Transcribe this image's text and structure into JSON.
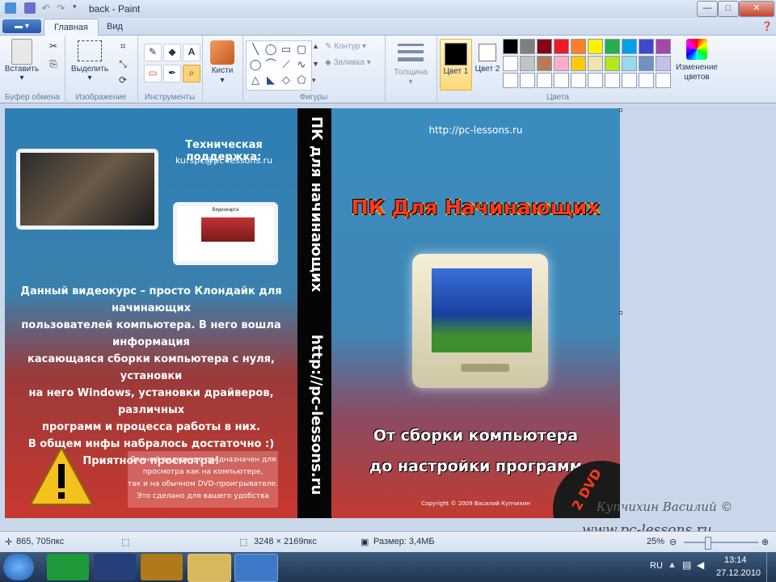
{
  "window": {
    "title": "back - Paint",
    "minimize_glyph": "—",
    "maximize_glyph": "□",
    "close_glyph": "✕"
  },
  "tabs": {
    "menu_glyph": "▬ ▾",
    "home": "Главная",
    "view": "Вид"
  },
  "ribbon": {
    "clipboard": {
      "paste": "Вставить",
      "label": "Буфер обмена"
    },
    "image": {
      "select": "Выделить",
      "label": "Изображение"
    },
    "tools": {
      "label": "Инструменты",
      "pencil": "✎",
      "fill": "◆",
      "text": "A",
      "eraser": "▭",
      "picker": "✒",
      "magnifier": "⌕"
    },
    "brushes": {
      "label": "Кисти"
    },
    "shapes": {
      "label": "Фигуры",
      "outline": "Контур",
      "fill": "Заливка",
      "items": [
        "╲",
        "◯",
        "▭",
        "▢",
        "◯",
        "⌒",
        "⟋",
        "∿",
        "△",
        "◣",
        "◇",
        "⬠",
        "⬡",
        "▷",
        "⟡",
        "☆",
        "✦",
        "✧"
      ]
    },
    "size": {
      "label": "Толщина"
    },
    "colors": {
      "color1_label": "Цвет 1",
      "color2_label": "Цвет 2",
      "label": "Цвета",
      "edit": "Изменение цветов",
      "color1": "#000000",
      "color2": "#ffffff",
      "palette": [
        "#000000",
        "#7f7f7f",
        "#880015",
        "#ed1c24",
        "#ff7f27",
        "#fff200",
        "#22b14c",
        "#00a2e8",
        "#3f48cc",
        "#a349a4",
        "#ffffff",
        "#c3c3c3",
        "#b97a57",
        "#ffaec9",
        "#ffc90e",
        "#efe4b0",
        "#b5e61d",
        "#99d9ea",
        "#7092be",
        "#c8bfe7"
      ]
    }
  },
  "cover": {
    "back": {
      "support_title": "Техническая поддержка:",
      "support_email": "kurspc@pc-lessons.ru",
      "thumb2_title": "Видеокарта",
      "paragraph": [
        "Данный видеокурс – просто Клондайк для начинающих",
        "пользователей компьютера. В него вошла информация",
        "касающаяся сборки компьютера с нуля, установки",
        "на него Windows, установки драйверов, различных",
        "программ и процесса работы в них.",
        "В общем инфы набралось достаточно :)",
        "Приятного просмотра!"
      ],
      "note": [
        "Данный видеокурс предназначен для",
        "просмотра как на компьютере,",
        "так и на обычном DVD-проигрывателе.",
        "Это сделано для вашего удобства"
      ]
    },
    "spine": {
      "title": "ПК для начинающих",
      "url": "http://pc-lessons.ru"
    },
    "front": {
      "url": "http://pc-lessons.ru",
      "title": "ПК Для Начинающих",
      "subtitle_1": "От сборки компьютера",
      "subtitle_2": "до настройки программ",
      "copyright": "Copyright © 2009 Василий Купчихин",
      "badge": "2 DVD"
    }
  },
  "watermark": {
    "author": "Купчихин Василий ©",
    "site": "www.pc-lessons.ru"
  },
  "status": {
    "cursor": "865, 705пкс",
    "dimensions": "3248 × 2169пкс",
    "size": "Размер: 3,4МБ",
    "zoom": "25%"
  },
  "taskbar": {
    "language": "RU",
    "time": "13:14",
    "date": "27.12.2010"
  }
}
